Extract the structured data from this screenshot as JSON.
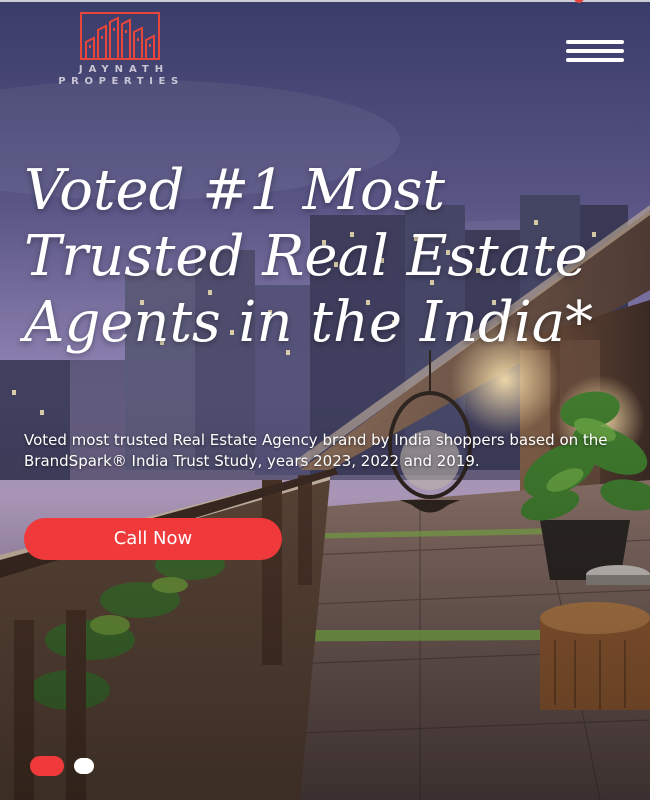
{
  "brand": {
    "name_line1": "JAYNATH",
    "name_line2": "PROPERTIES",
    "logo_color": "#e8463a"
  },
  "header": {
    "menu_icon": "hamburger-menu-icon"
  },
  "hero": {
    "headline": "Voted #1 Most Trusted Real Estate Agents in the India*",
    "subtext": "Voted most trusted Real Estate Agency brand by India shoppers based on the BrandSpark® India Trust Study, years 2023, 2022 and 2019.",
    "cta_label": "Call Now",
    "cta_color": "#f0393a",
    "background_image": "dusk-balcony-city-view"
  },
  "slider": {
    "total_slides": 2,
    "active_slide": 1,
    "active_color": "#f0393a",
    "inactive_color": "#ffffff"
  }
}
